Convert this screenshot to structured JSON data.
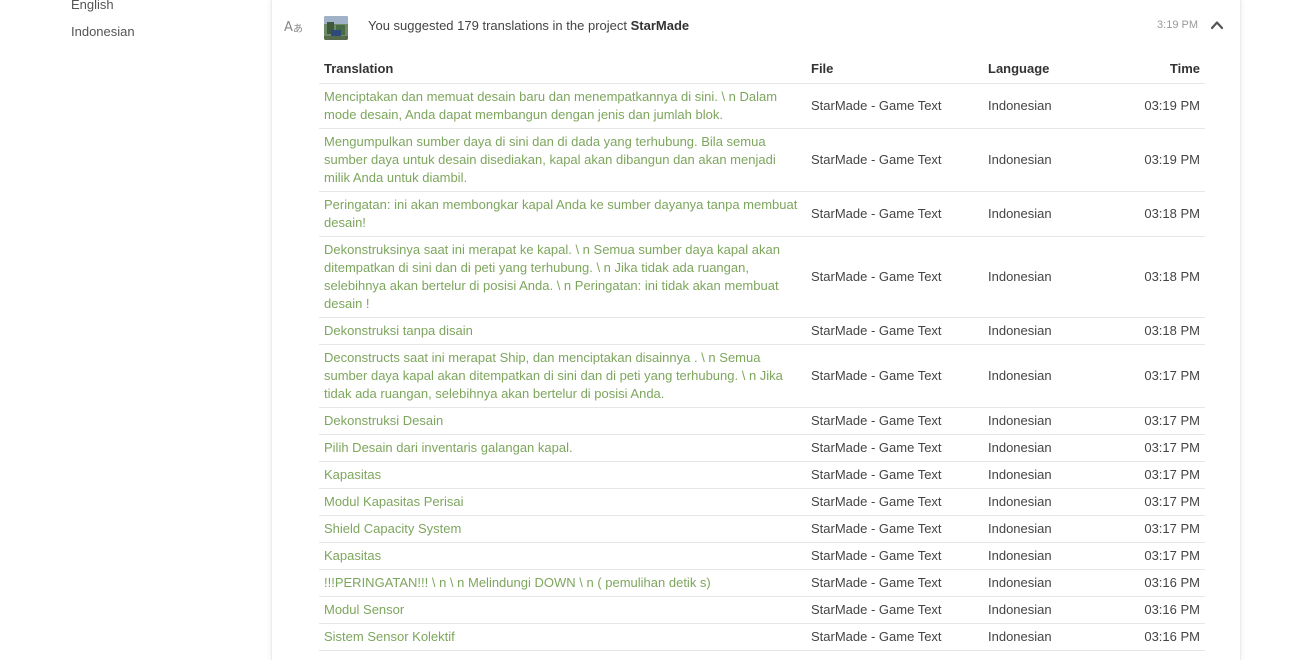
{
  "sidebar": {
    "languages": [
      "English",
      "Indonesian"
    ]
  },
  "activity": {
    "icon": "translate-icon",
    "summary_prefix": "You suggested 179 translations in the project",
    "project_name": "StarMade",
    "time": "3:19 PM",
    "collapse_icon": "chevron-up-icon"
  },
  "table": {
    "headers": {
      "translation": "Translation",
      "file": "File",
      "language": "Language",
      "time": "Time"
    },
    "rows": [
      {
        "translation": "Menciptakan dan memuat desain baru dan menempatkannya di sini. \\ n Dalam mode desain, Anda dapat membangun dengan jenis dan jumlah blok.",
        "file": "StarMade - Game Text",
        "language": "Indonesian",
        "time": "03:19 PM"
      },
      {
        "translation": "Mengumpulkan sumber daya di sini dan di dada yang terhubung. Bila semua sumber daya untuk desain disediakan, kapal akan dibangun dan akan menjadi milik Anda untuk diambil.",
        "file": "StarMade - Game Text",
        "language": "Indonesian",
        "time": "03:19 PM"
      },
      {
        "translation": "Peringatan: ini akan membongkar kapal Anda ke sumber dayanya tanpa membuat desain!",
        "file": "StarMade - Game Text",
        "language": "Indonesian",
        "time": "03:18 PM"
      },
      {
        "translation": "Dekonstruksinya saat ini merapat ke kapal. \\ n Semua sumber daya kapal akan ditempatkan di sini dan di peti yang terhubung. \\ n Jika tidak ada ruangan, selebihnya akan bertelur di posisi Anda. \\ n Peringatan: ini tidak akan membuat desain !",
        "file": "StarMade - Game Text",
        "language": "Indonesian",
        "time": "03:18 PM"
      },
      {
        "translation": "Dekonstruksi tanpa disain",
        "file": "StarMade - Game Text",
        "language": "Indonesian",
        "time": "03:18 PM"
      },
      {
        "translation": "Deconstructs saat ini merapat Ship, dan menciptakan disainnya . \\ n Semua sumber daya kapal akan ditempatkan di sini dan di peti yang terhubung. \\ n Jika tidak ada ruangan, selebihnya akan bertelur di posisi Anda.",
        "file": "StarMade - Game Text",
        "language": "Indonesian",
        "time": "03:17 PM"
      },
      {
        "translation": "Dekonstruksi Desain",
        "file": "StarMade - Game Text",
        "language": "Indonesian",
        "time": "03:17 PM"
      },
      {
        "translation": "Pilih Desain dari inventaris galangan kapal.",
        "file": "StarMade - Game Text",
        "language": "Indonesian",
        "time": "03:17 PM"
      },
      {
        "translation": "Kapasitas",
        "file": "StarMade - Game Text",
        "language": "Indonesian",
        "time": "03:17 PM"
      },
      {
        "translation": "Modul Kapasitas Perisai",
        "file": "StarMade - Game Text",
        "language": "Indonesian",
        "time": "03:17 PM"
      },
      {
        "translation": "Shield Capacity System",
        "file": "StarMade - Game Text",
        "language": "Indonesian",
        "time": "03:17 PM"
      },
      {
        "translation": "Kapasitas",
        "file": "StarMade - Game Text",
        "language": "Indonesian",
        "time": "03:17 PM"
      },
      {
        "translation": "!!!PERINGATAN!!! \\ n \\ n Melindungi DOWN \\ n ( pemulihan detik s)",
        "file": "StarMade - Game Text",
        "language": "Indonesian",
        "time": "03:16 PM"
      },
      {
        "translation": "Modul Sensor",
        "file": "StarMade - Game Text",
        "language": "Indonesian",
        "time": "03:16 PM"
      },
      {
        "translation": "Sistem Sensor Kolektif",
        "file": "StarMade - Game Text",
        "language": "Indonesian",
        "time": "03:16 PM"
      }
    ]
  },
  "colors": {
    "link_green": "#7da65d",
    "divider": "#e6e6e6",
    "muted_text": "#999999"
  }
}
